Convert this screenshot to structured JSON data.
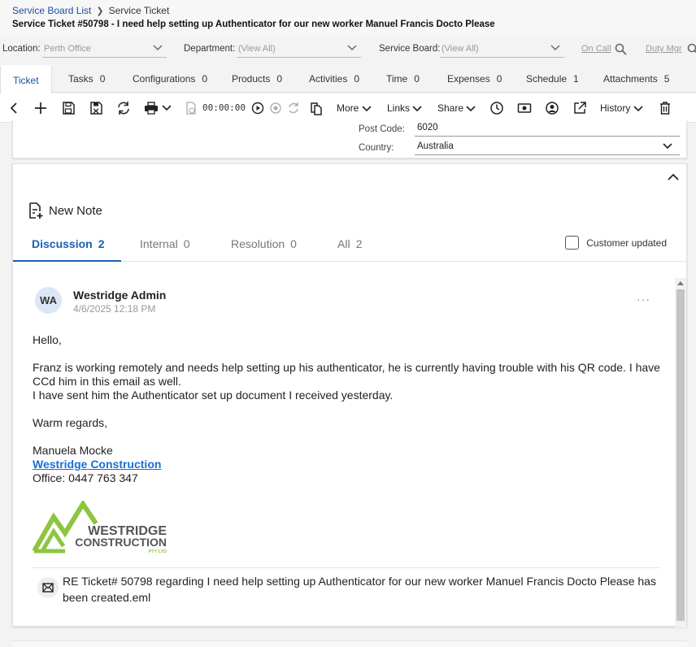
{
  "breadcrumb": {
    "parent": "Service Board List",
    "current": "Service Ticket"
  },
  "ticket": {
    "title": "Service Ticket #50798 - I need help setting up Authenticator for our new worker Manuel Francis Docto Please"
  },
  "filters": {
    "location_label": "Location:",
    "location_value": "Perth Office",
    "department_label": "Department:",
    "department_value": "(View All)",
    "board_label": "Service Board:",
    "board_value": "(View All)",
    "on_call": "On Call",
    "duty_mgr": "Duty Mgr"
  },
  "tabs": [
    {
      "label": "Ticket",
      "count": ""
    },
    {
      "label": "Tasks",
      "count": "0"
    },
    {
      "label": "Configurations",
      "count": "0"
    },
    {
      "label": "Products",
      "count": "0"
    },
    {
      "label": "Activities",
      "count": "0"
    },
    {
      "label": "Time",
      "count": "0"
    },
    {
      "label": "Expenses",
      "count": "0"
    },
    {
      "label": "Schedule",
      "count": "1"
    },
    {
      "label": "Attachments",
      "count": "5"
    }
  ],
  "toolbar": {
    "timer": "00:00:00",
    "more": "More",
    "links": "Links",
    "share": "Share",
    "history": "History"
  },
  "address": {
    "postcode_label": "Post Code:",
    "postcode": "6020",
    "country_label": "Country:",
    "country": "Australia"
  },
  "notes": {
    "new_note": "New Note",
    "tabs": [
      {
        "label": "Discussion",
        "count": "2"
      },
      {
        "label": "Internal",
        "count": "0"
      },
      {
        "label": "Resolution",
        "count": "0"
      },
      {
        "label": "All",
        "count": "2"
      }
    ],
    "customer_updated": "Customer updated"
  },
  "note": {
    "initials": "WA",
    "author": "Westridge Admin",
    "time": "4/6/2025 12:18 PM",
    "greeting": "Hello,",
    "para1": "Franz is working remotely and needs help setting up his authenticator, he is currently having trouble with his QR code. I have CCd him in this email as well.",
    "para2": "I have sent him the Authenticator set up document I received yesterday.",
    "signoff": "Warm regards,",
    "sender": "Manuela Mocke",
    "company_link": "Westridge Construction",
    "office": "Office: 0447 763 347",
    "logo_line1": "WESTRIDGE",
    "logo_line2": "CONSTRUCTION",
    "logo_line3": "PTY LTD",
    "attachment": "RE Ticket# 50798 regarding I need help setting up Authenticator for our new worker Manuel Francis Docto Please has been created.eml"
  },
  "colors": {
    "link": "#1a4fa0",
    "accent": "#1a5fb4",
    "logo_green": "#8cc63f",
    "logo_gray": "#555555"
  }
}
